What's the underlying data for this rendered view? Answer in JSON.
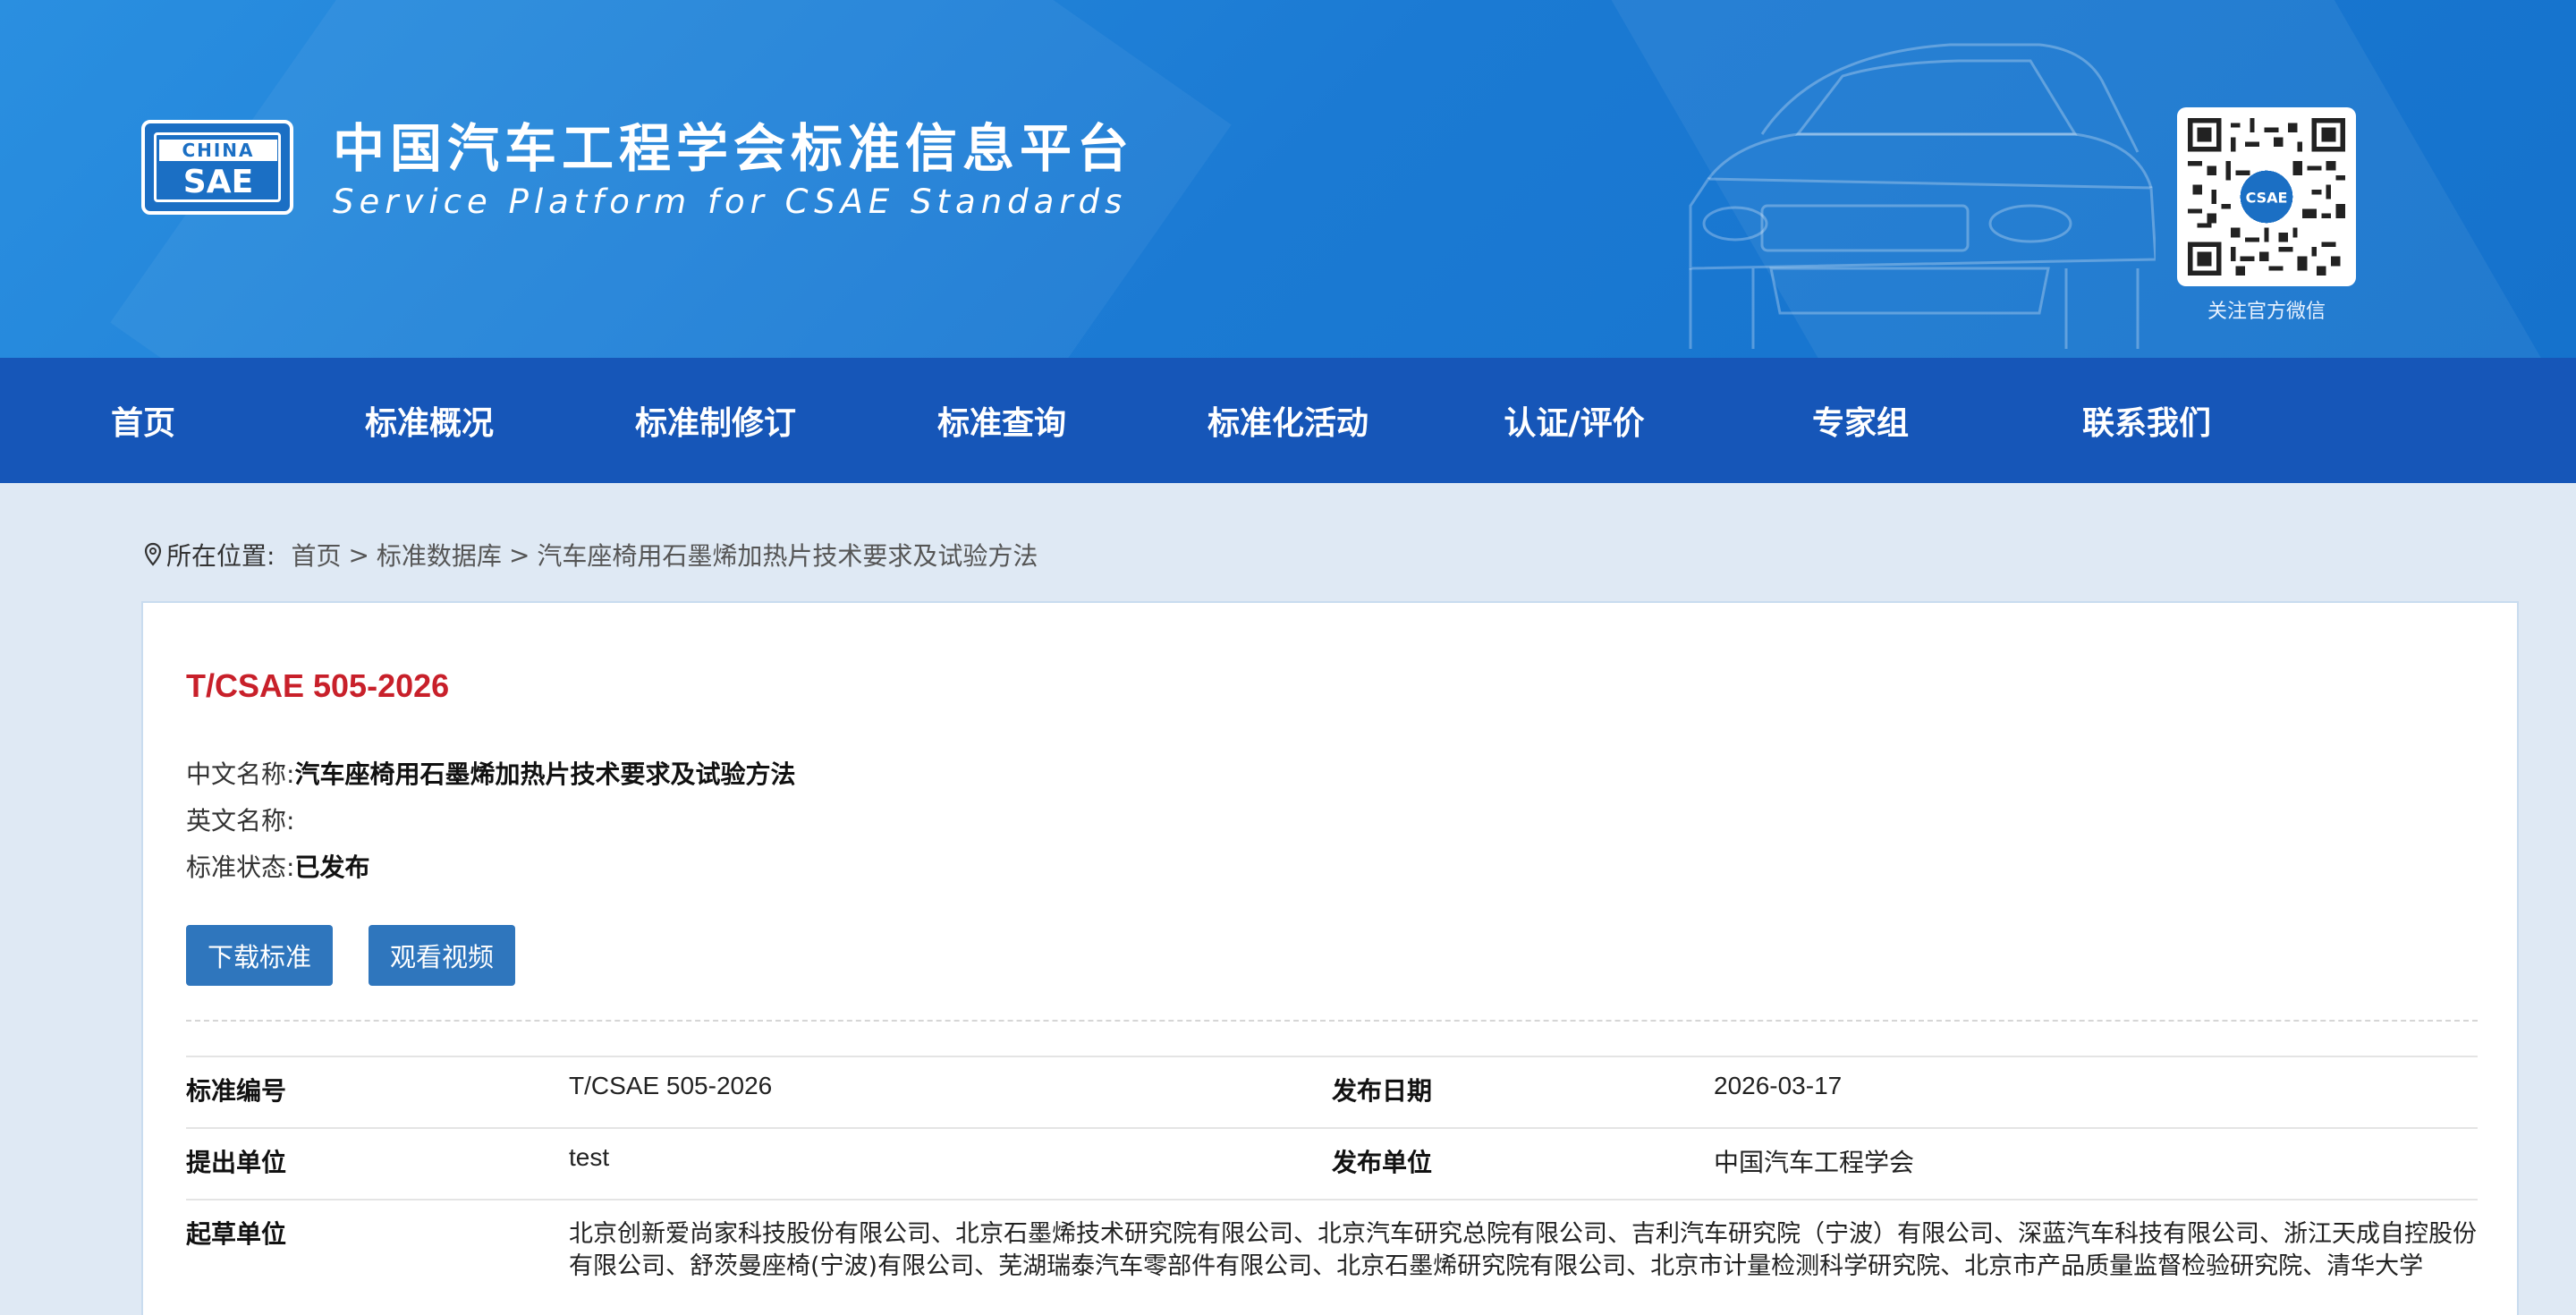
{
  "header": {
    "logo_top": "CHINA",
    "logo_main": "SAE",
    "title": "中国汽车工程学会标准信息平台",
    "subtitle": "Service Platform for CSAE Standards",
    "qr_caption": "关注官方微信",
    "qr_badge": "CSAE"
  },
  "nav": {
    "items": [
      "首页",
      "标准概况",
      "标准制修订",
      "标准查询",
      "标准化活动",
      "认证/评价",
      "专家组",
      "联系我们"
    ]
  },
  "breadcrumb": {
    "label": "所在位置:",
    "items": [
      "首页",
      "标准数据库",
      "汽车座椅用石墨烯加热片技术要求及试验方法"
    ],
    "separator": ">"
  },
  "standard": {
    "code": "T/CSAE 505-2026",
    "cn_name_label": "中文名称:",
    "cn_name": "汽车座椅用石墨烯加热片技术要求及试验方法",
    "en_name_label": "英文名称:",
    "en_name": "",
    "status_label": "标准状态:",
    "status": "已发布",
    "download_button": "下载标准",
    "video_button": "观看视频"
  },
  "details": {
    "rows": [
      {
        "label1": "标准编号",
        "value1": "T/CSAE 505-2026",
        "label2": "发布日期",
        "value2": "2026-03-17"
      },
      {
        "label1": "提出单位",
        "value1": "test",
        "label2": "发布单位",
        "value2": "中国汽车工程学会"
      }
    ],
    "drafters_label": "起草单位",
    "drafters": "北京创新爱尚家科技股份有限公司、北京石墨烯技术研究院有限公司、北京汽车研究总院有限公司、吉利汽车研究院（宁波）有限公司、深蓝汽车科技有限公司、浙江天成自控股份有限公司、舒茨曼座椅(宁波)有限公司、芜湖瑞泰汽车零部件有限公司、北京石墨烯研究院有限公司、北京市计量检测科学研究院、北京市产品质量监督检验研究院、清华大学"
  },
  "colors": {
    "banner": "#1b7ad3",
    "nav": "#1656b8",
    "code_red": "#c8202a",
    "button": "#2f76bd"
  }
}
